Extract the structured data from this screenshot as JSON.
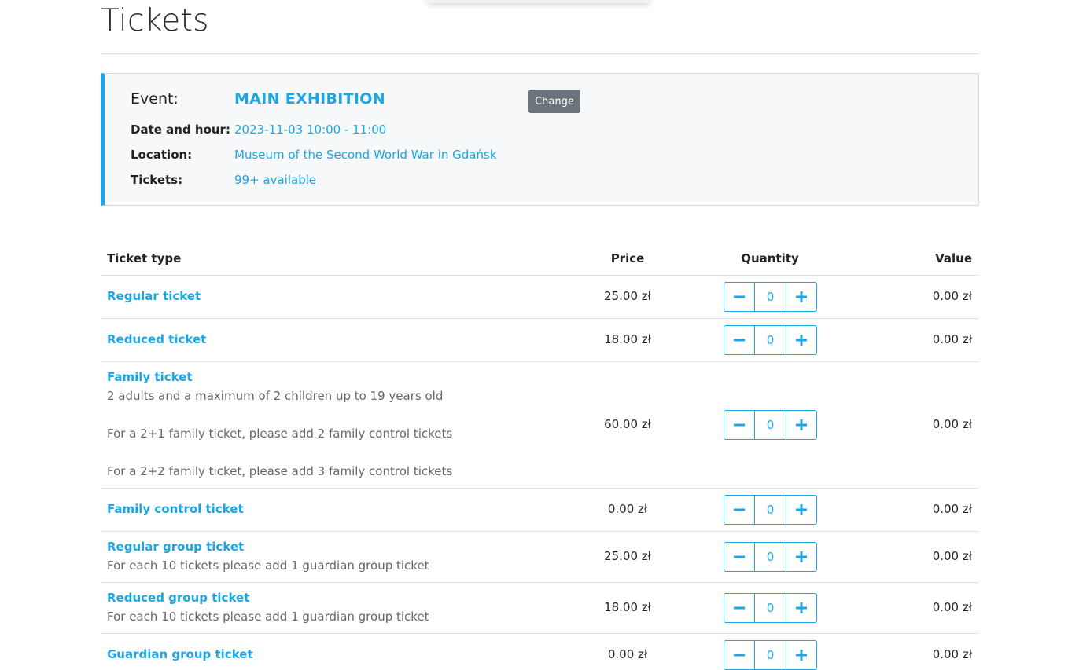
{
  "page": {
    "title": "Tickets"
  },
  "event": {
    "event_label": "Event:",
    "event_name": "MAIN EXHIBITION",
    "date_label": "Date and hour:",
    "date_value": "2023-11-03 10:00 - 11:00",
    "location_label": "Location:",
    "location_value": "Museum of the Second World War in Gdańsk",
    "tickets_label": "Tickets:",
    "tickets_value": "99+ available",
    "change_label": "Change"
  },
  "table": {
    "headers": {
      "type": "Ticket type",
      "price": "Price",
      "quantity": "Quantity",
      "value": "Value"
    },
    "rows": [
      {
        "name": "Regular ticket",
        "price": "25.00 zł",
        "quantity": "0",
        "value": "0.00 zł"
      },
      {
        "name": "Reduced ticket",
        "price": "18.00 zł",
        "quantity": "0",
        "value": "0.00 zł"
      },
      {
        "name": "Family ticket",
        "desc1": "2 adults and a maximum of 2 children up to 19 years old",
        "desc2": "For a 2+1 family ticket, please add 2 family control tickets",
        "desc3": "For a 2+2 family ticket, please add 3 family control tickets",
        "price": "60.00 zł",
        "quantity": "0",
        "value": "0.00 zł"
      },
      {
        "name": "Family control ticket",
        "price": "0.00 zł",
        "quantity": "0",
        "value": "0.00 zł"
      },
      {
        "name": "Regular group ticket",
        "desc1": "For each 10 tickets please add 1 guardian group ticket",
        "price": "25.00 zł",
        "quantity": "0",
        "value": "0.00 zł"
      },
      {
        "name": "Reduced group ticket",
        "desc1": "For each 10 tickets please add 1 guardian group ticket",
        "price": "18.00 zł",
        "quantity": "0",
        "value": "0.00 zł"
      },
      {
        "name": "Guardian group ticket",
        "price": "0.00 zł",
        "quantity": "0",
        "value": "0.00 zł"
      }
    ]
  },
  "icons": {
    "decrement": "minus-icon",
    "increment": "plus-icon"
  },
  "colors": {
    "accent": "#1aa7e3",
    "button_secondary": "#6c757d"
  }
}
